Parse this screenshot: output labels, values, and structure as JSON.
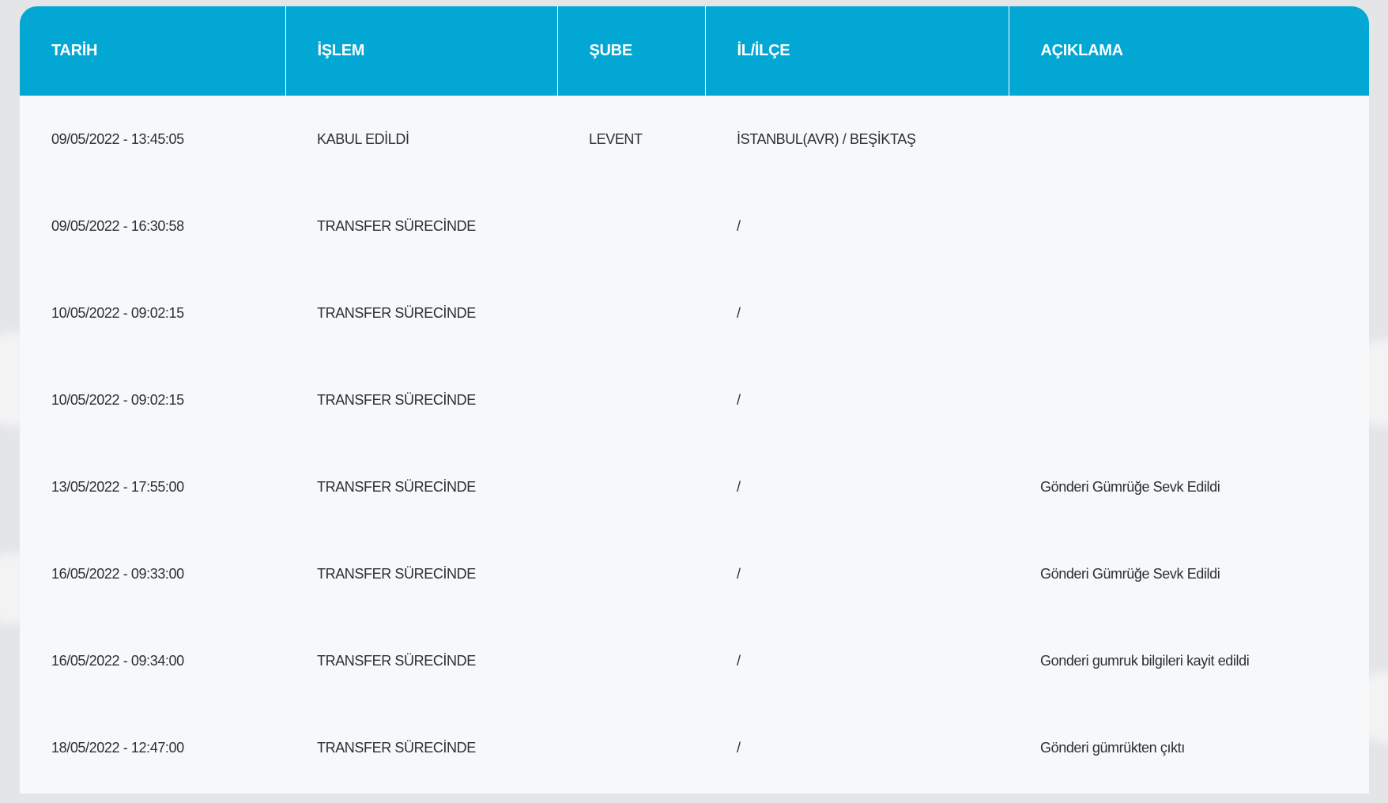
{
  "table": {
    "headers": [
      "TARİH",
      "İŞLEM",
      "ŞUBE",
      "İL/İLÇE",
      "AÇIKLAMA"
    ],
    "rows": [
      [
        "09/05/2022 - 13:45:05",
        "KABUL EDİLDİ",
        "LEVENT",
        "İSTANBUL(AVR) / BEŞİKTAŞ",
        ""
      ],
      [
        "09/05/2022 - 16:30:58",
        "TRANSFER SÜRECİNDE",
        "",
        "/",
        ""
      ],
      [
        "10/05/2022 - 09:02:15",
        "TRANSFER SÜRECİNDE",
        "",
        "/",
        ""
      ],
      [
        "10/05/2022 - 09:02:15",
        "TRANSFER SÜRECİNDE",
        "",
        "/",
        ""
      ],
      [
        "13/05/2022 - 17:55:00",
        "TRANSFER SÜRECİNDE",
        "",
        "/",
        "Gönderi Gümrüğe Sevk Edildi"
      ],
      [
        "16/05/2022 - 09:33:00",
        "TRANSFER SÜRECİNDE",
        "",
        "/",
        "Gönderi Gümrüğe Sevk Edildi"
      ],
      [
        "16/05/2022 - 09:34:00",
        "TRANSFER SÜRECİNDE",
        "",
        "/",
        "Gonderi gumruk bilgileri kayit edildi"
      ],
      [
        "18/05/2022 - 12:47:00",
        "TRANSFER SÜRECİNDE",
        "",
        "/",
        "Gönderi gümrükten çıktı"
      ]
    ]
  },
  "colors": {
    "header_bg": "#03a7d3",
    "header_text": "#ffffff",
    "body_bg": "#f6f8fa",
    "body_text": "#2b2f36"
  }
}
